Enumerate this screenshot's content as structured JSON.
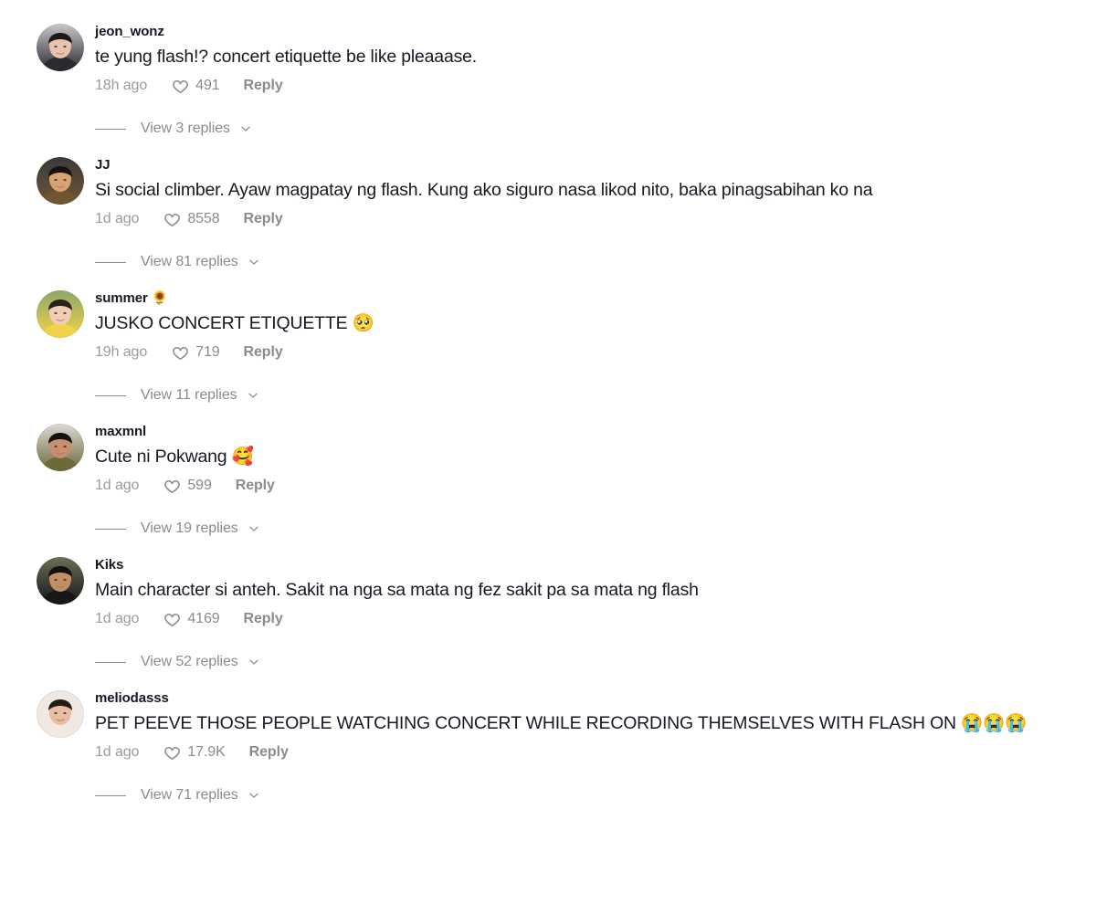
{
  "comments": [
    {
      "username": "jeon_wonz",
      "text": "te yung flash!? concert etiquette be like pleaaase.",
      "time": "18h ago",
      "likes": "491",
      "reply_label": "Reply",
      "view_replies": "View 3 replies",
      "avatar_name": "avatar-jeon-wonz",
      "avatar_colors": {
        "bg": "#c9c5cb",
        "skin": "#e8c3ae",
        "hair": "#1d1a19",
        "shirt": "#2a2a30"
      }
    },
    {
      "username": "JJ",
      "text": "Si social climber. Ayaw magpatay ng flash. Kung ako siguro nasa likod nito, baka pinagsabihan ko na",
      "time": "1d ago",
      "likes": "8558",
      "reply_label": "Reply",
      "view_replies": "View 81 replies",
      "avatar_name": "avatar-jj",
      "avatar_colors": {
        "bg": "#3b3a3c",
        "skin": "#d8a273",
        "hair": "#161110",
        "shirt": "#6e5633"
      }
    },
    {
      "username": "summer 🌻",
      "text": "JUSKO CONCERT ETIQUETTE 🥺",
      "time": "19h ago",
      "likes": "719",
      "reply_label": "Reply",
      "view_replies": "View 11 replies",
      "avatar_name": "avatar-summer",
      "avatar_colors": {
        "bg": "#8fa76a",
        "skin": "#f0cdb4",
        "hair": "#2a211c",
        "shirt": "#f2d24b"
      }
    },
    {
      "username": "maxmnl",
      "text": "Cute ni Pokwang 🥰",
      "time": "1d ago",
      "likes": "599",
      "reply_label": "Reply",
      "view_replies": "View 19 replies",
      "avatar_name": "avatar-maxmnl",
      "avatar_colors": {
        "bg": "#dcd8d4",
        "skin": "#c69070",
        "hair": "#15110f",
        "shirt": "#6d6a3a"
      }
    },
    {
      "username": "Kiks",
      "text": "Main character si anteh. Sakit na nga sa mata ng fez sakit pa sa mata ng flash",
      "time": "1d ago",
      "likes": "4169",
      "reply_label": "Reply",
      "view_replies": "View 52 replies",
      "avatar_name": "avatar-kiks",
      "avatar_colors": {
        "bg": "#6b6e54",
        "skin": "#c08f66",
        "hair": "#120f0d",
        "shirt": "#17161a"
      }
    },
    {
      "username": "meliodasss",
      "text": "PET PEEVE THOSE PEOPLE WATCHING CONCERT WHILE RECORDING THEMSELVES WITH FLASH ON 😭😭😭",
      "time": "1d ago",
      "likes": "17.9K",
      "reply_label": "Reply",
      "view_replies": "View 71 replies",
      "avatar_name": "avatar-meliodasss",
      "avatar_colors": {
        "bg": "#efe7e2",
        "skin": "#e9bda3",
        "hair": "#241a16",
        "shirt": "#f3e9e3"
      }
    }
  ],
  "icons": {
    "heart": "heart-outline-icon",
    "chevron": "chevron-down-icon"
  },
  "colors": {
    "text": "#161823",
    "muted": "#8a8b91",
    "background": "#ffffff"
  }
}
